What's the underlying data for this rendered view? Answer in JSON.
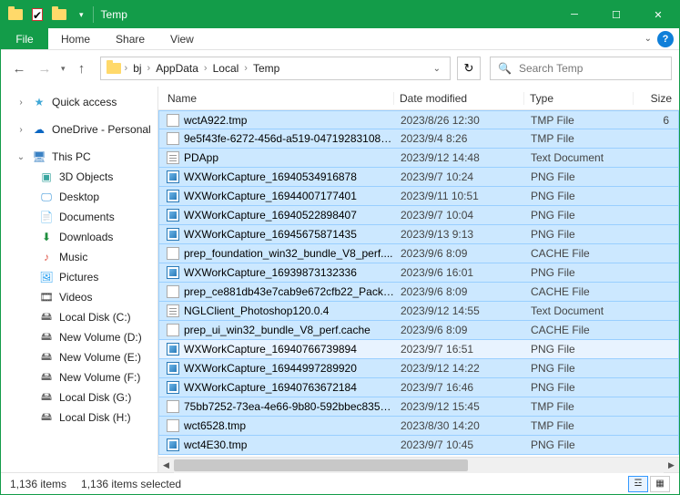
{
  "window": {
    "title": "Temp"
  },
  "menu": {
    "file": "File",
    "home": "Home",
    "share": "Share",
    "view": "View"
  },
  "breadcrumbs": [
    "bj",
    "AppData",
    "Local",
    "Temp"
  ],
  "search_placeholder": "Search Temp",
  "columns": {
    "name": "Name",
    "date": "Date modified",
    "type": "Type",
    "size": "Size"
  },
  "sidebar": {
    "quick": "Quick access",
    "onedrive": "OneDrive - Personal",
    "thispc": "This PC",
    "children": [
      "3D Objects",
      "Desktop",
      "Documents",
      "Downloads",
      "Music",
      "Pictures",
      "Videos",
      "Local Disk (C:)",
      "New Volume (D:)",
      "New Volume (E:)",
      "New Volume (F:)",
      "Local Disk (G:)",
      "Local Disk (H:)"
    ]
  },
  "files": [
    {
      "icon": "doc",
      "name": "wctA922.tmp",
      "date": "2023/8/26 12:30",
      "type": "TMP File",
      "size": "6"
    },
    {
      "icon": "doc",
      "name": "9e5f43fe-6272-456d-a519-04719283108b.t...",
      "date": "2023/9/4 8:26",
      "type": "TMP File",
      "size": ""
    },
    {
      "icon": "txt",
      "name": "PDApp",
      "date": "2023/9/12 14:48",
      "type": "Text Document",
      "size": ""
    },
    {
      "icon": "png",
      "name": "WXWorkCapture_16940534916878",
      "date": "2023/9/7 10:24",
      "type": "PNG File",
      "size": ""
    },
    {
      "icon": "png",
      "name": "WXWorkCapture_16944007177401",
      "date": "2023/9/11 10:51",
      "type": "PNG File",
      "size": ""
    },
    {
      "icon": "png",
      "name": "WXWorkCapture_16940522898407",
      "date": "2023/9/7 10:04",
      "type": "PNG File",
      "size": ""
    },
    {
      "icon": "png",
      "name": "WXWorkCapture_16945675871435",
      "date": "2023/9/13 9:13",
      "type": "PNG File",
      "size": ""
    },
    {
      "icon": "doc",
      "name": "prep_foundation_win32_bundle_V8_perf....",
      "date": "2023/9/6 8:09",
      "type": "CACHE File",
      "size": ""
    },
    {
      "icon": "png",
      "name": "WXWorkCapture_16939873132336",
      "date": "2023/9/6 16:01",
      "type": "PNG File",
      "size": ""
    },
    {
      "icon": "doc",
      "name": "prep_ce881db43e7cab9e672cfb22_Packa...",
      "date": "2023/9/6 8:09",
      "type": "CACHE File",
      "size": ""
    },
    {
      "icon": "txt",
      "name": "NGLClient_Photoshop120.0.4",
      "date": "2023/9/12 14:55",
      "type": "Text Document",
      "size": ""
    },
    {
      "icon": "doc",
      "name": "prep_ui_win32_bundle_V8_perf.cache",
      "date": "2023/9/6 8:09",
      "type": "CACHE File",
      "size": ""
    },
    {
      "icon": "png",
      "name": "WXWorkCapture_16940766739894",
      "date": "2023/9/7 16:51",
      "type": "PNG File",
      "size": ""
    },
    {
      "icon": "png",
      "name": "WXWorkCapture_16944997289920",
      "date": "2023/9/12 14:22",
      "type": "PNG File",
      "size": ""
    },
    {
      "icon": "png",
      "name": "WXWorkCapture_16940763672184",
      "date": "2023/9/7 16:46",
      "type": "PNG File",
      "size": ""
    },
    {
      "icon": "doc",
      "name": "75bb7252-73ea-4e66-9b80-592bbec835d...",
      "date": "2023/9/12 15:45",
      "type": "TMP File",
      "size": ""
    },
    {
      "icon": "doc",
      "name": "wct6528.tmp",
      "date": "2023/8/30 14:20",
      "type": "TMP File",
      "size": ""
    },
    {
      "icon": "png",
      "name": "wct4E30.tmp",
      "date": "2023/9/7 10:45",
      "type": "PNG File",
      "size": ""
    }
  ],
  "status": {
    "items": "1,136 items",
    "selected": "1,136 items selected"
  }
}
